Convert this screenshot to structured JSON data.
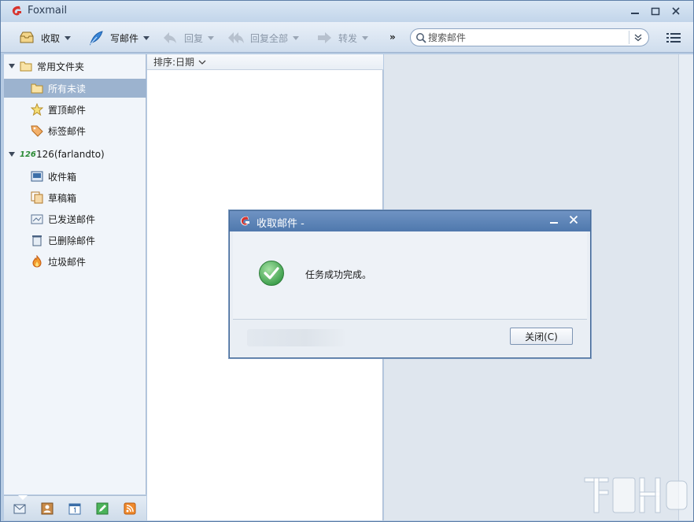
{
  "window": {
    "title": "Foxmail"
  },
  "toolbar": {
    "receive": "收取",
    "compose": "写邮件",
    "reply": "回复",
    "reply_all": "回复全部",
    "forward": "转发",
    "more": "»",
    "search_placeholder": "搜索邮件"
  },
  "sidebar": {
    "groups": [
      {
        "label": "常用文件夹",
        "items": [
          "所有未读",
          "置顶邮件",
          "标签邮件"
        ]
      },
      {
        "label": "126(farlandto)",
        "tag": "126",
        "items": [
          "收件箱",
          "草稿箱",
          "已发送邮件",
          "已删除邮件",
          "垃圾邮件"
        ]
      }
    ]
  },
  "maillist": {
    "sort_label": "排序:日期"
  },
  "dialog": {
    "title": "收取邮件 -",
    "message": "任务成功完成。",
    "close_button": "关闭(C)"
  },
  "colors": {
    "accent": "#4f78ad",
    "selected": "#9cb3cf",
    "brand_red": "#d8322b",
    "success_green": "#4bb35a"
  }
}
